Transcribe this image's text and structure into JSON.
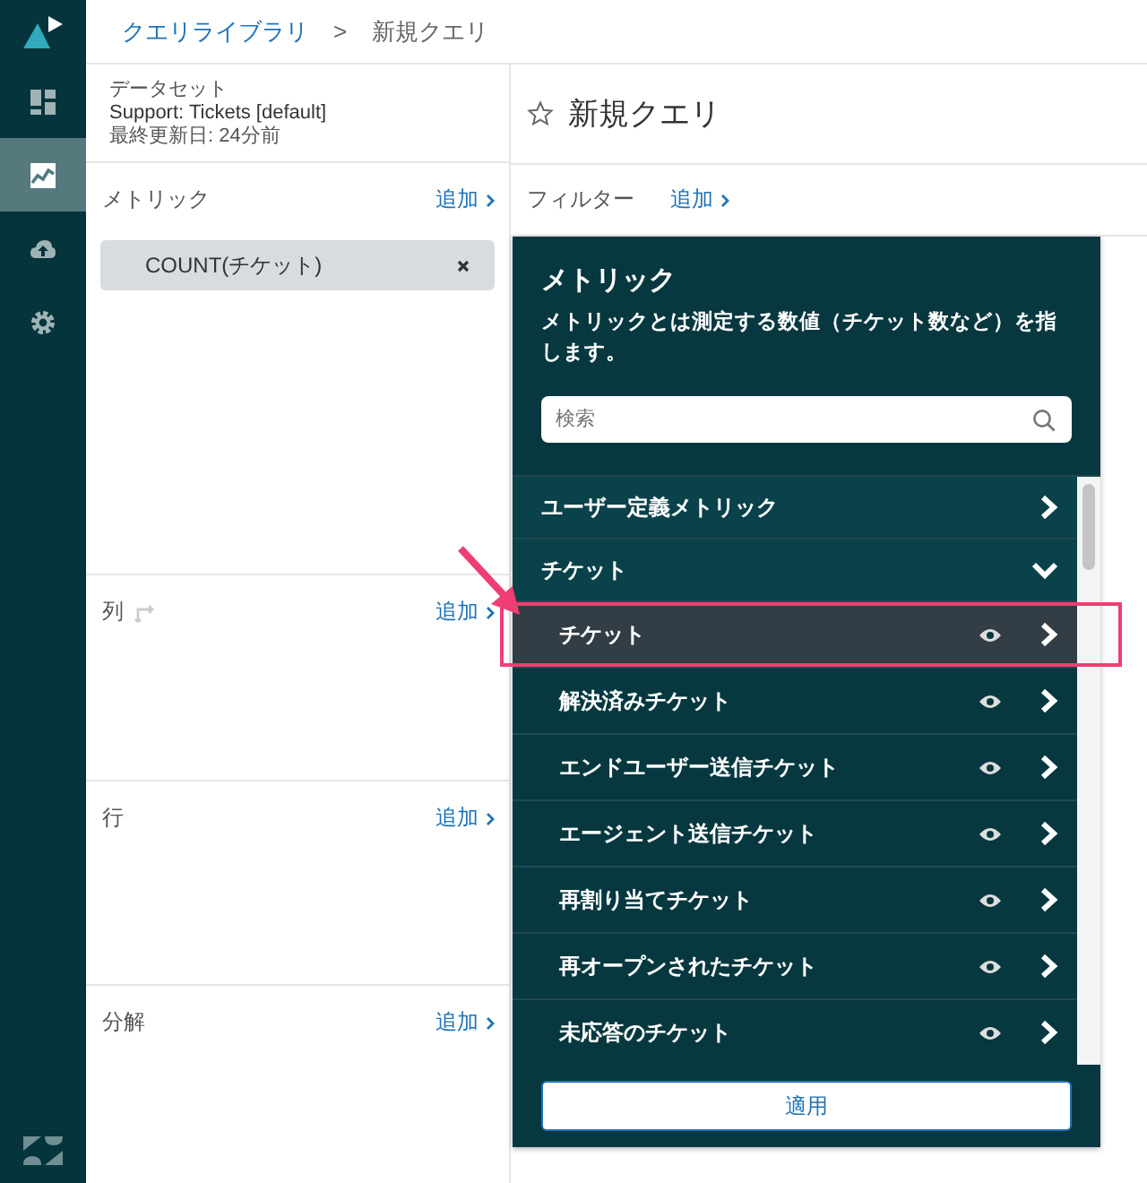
{
  "sidebar": {
    "items": [
      {
        "kind": "dashboard",
        "selected": false
      },
      {
        "kind": "chart",
        "selected": true
      },
      {
        "kind": "upload",
        "selected": false
      },
      {
        "kind": "settings",
        "selected": false
      }
    ]
  },
  "breadcrumb": {
    "link": "クエリライブラリ",
    "separator": ">",
    "current": "新規クエリ"
  },
  "dataset": {
    "label": "データセット",
    "name": "Support: Tickets [default]",
    "updated": "最終更新日: 24分前"
  },
  "sections": [
    {
      "kind": "metrics",
      "label": "メトリック",
      "action": "追加",
      "chips": [
        "COUNT(チケット)"
      ]
    },
    {
      "kind": "columns",
      "label": "列",
      "action": "追加"
    },
    {
      "kind": "rows",
      "label": "行",
      "action": "追加"
    },
    {
      "kind": "explode",
      "label": "分解",
      "action": "追加"
    }
  ],
  "query": {
    "title": "新規クエリ",
    "filter_label": "フィルター",
    "filter_action": "追加"
  },
  "picker": {
    "title": "メトリック",
    "description": "メトリックとは測定する数値（チケット数など）を指します。",
    "search": {
      "placeholder": "検索"
    },
    "groups": [
      {
        "label": "ユーザー定義メトリック",
        "expanded": false
      },
      {
        "label": "チケット",
        "expanded": true,
        "children": [
          {
            "label": "チケット",
            "selected": true
          },
          {
            "label": "解決済みチケット",
            "selected": false
          },
          {
            "label": "エンドユーザー送信チケット",
            "selected": false
          },
          {
            "label": "エージェント送信チケット",
            "selected": false
          },
          {
            "label": "再割り当てチケット",
            "selected": false
          },
          {
            "label": "再オープンされたチケット",
            "selected": false
          },
          {
            "label": "未応答のチケット",
            "selected": false
          }
        ]
      }
    ],
    "apply": "適用"
  }
}
